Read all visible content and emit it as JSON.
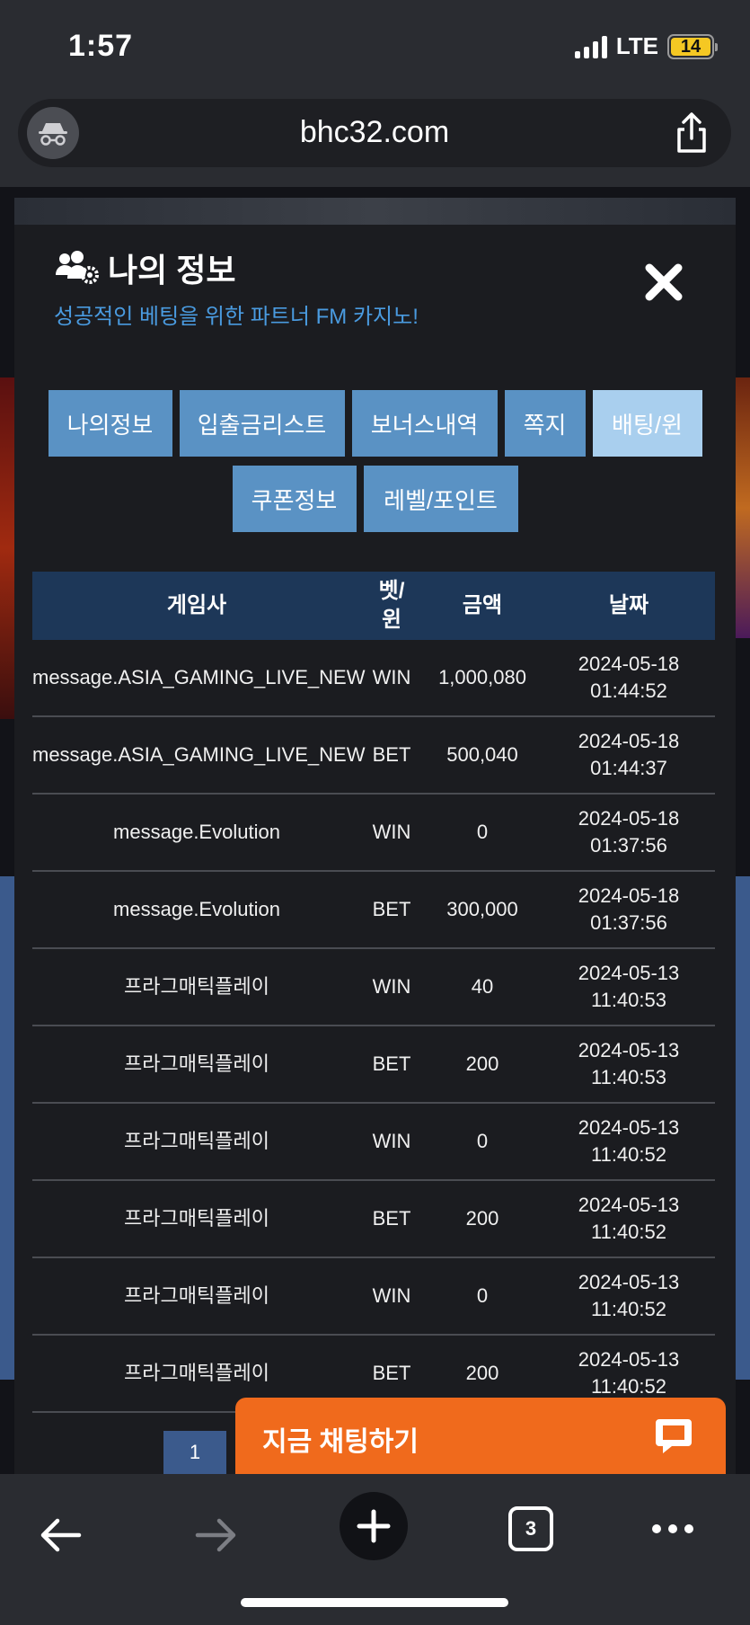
{
  "status_bar": {
    "time": "1:57",
    "network": "LTE",
    "battery": "14"
  },
  "browser": {
    "url": "bhc32.com"
  },
  "modal": {
    "title": "나의 정보",
    "subtitle": "성공적인 베팅을 위한 파트너 FM 카지노!",
    "tabs_row1": [
      {
        "label": "나의정보"
      },
      {
        "label": "입출금리스트"
      },
      {
        "label": "보너스내역"
      },
      {
        "label": "쪽지"
      },
      {
        "label": "배팅/윈"
      }
    ],
    "tabs_row2": [
      {
        "label": "쿠폰정보"
      },
      {
        "label": "레벨/포인트"
      }
    ],
    "active_tab": "배팅/윈"
  },
  "table": {
    "headers": {
      "provider": "게임사",
      "type": "벳/\n윈",
      "amount": "금액",
      "date": "날짜"
    },
    "rows": [
      {
        "provider": "message.ASIA_GAMING_LIVE_NEW",
        "type": "WIN",
        "amount": "1,000,080",
        "date": "2024-05-18",
        "time": "01:44:52"
      },
      {
        "provider": "message.ASIA_GAMING_LIVE_NEW",
        "type": "BET",
        "amount": "500,040",
        "date": "2024-05-18",
        "time": "01:44:37"
      },
      {
        "provider": "message.Evolution",
        "type": "WIN",
        "amount": "0",
        "date": "2024-05-18",
        "time": "01:37:56"
      },
      {
        "provider": "message.Evolution",
        "type": "BET",
        "amount": "300,000",
        "date": "2024-05-18",
        "time": "01:37:56"
      },
      {
        "provider": "프라그매틱플레이",
        "type": "WIN",
        "amount": "40",
        "date": "2024-05-13",
        "time": "11:40:53"
      },
      {
        "provider": "프라그매틱플레이",
        "type": "BET",
        "amount": "200",
        "date": "2024-05-13",
        "time": "11:40:53"
      },
      {
        "provider": "프라그매틱플레이",
        "type": "WIN",
        "amount": "0",
        "date": "2024-05-13",
        "time": "11:40:52"
      },
      {
        "provider": "프라그매틱플레이",
        "type": "BET",
        "amount": "200",
        "date": "2024-05-13",
        "time": "11:40:52"
      },
      {
        "provider": "프라그매틱플레이",
        "type": "WIN",
        "amount": "0",
        "date": "2024-05-13",
        "time": "11:40:52"
      },
      {
        "provider": "프라그매틱플레이",
        "type": "BET",
        "amount": "200",
        "date": "2024-05-13",
        "time": "11:40:52"
      }
    ]
  },
  "pagination": {
    "current_page": "1"
  },
  "chat": {
    "label": "지금 채팅하기"
  },
  "toolbar": {
    "tab_count": "3"
  },
  "colors": {
    "accent_blue": "#5a92c4",
    "active_tab": "#a9cfee",
    "header_bg": "#1d3758",
    "chat_orange": "#f06a1c",
    "subtitle_blue": "#4a9be0"
  },
  "icons": [
    "incognito-icon",
    "share-icon",
    "users-gear-icon",
    "close-icon",
    "chat-bubble-icon",
    "back-arrow-icon",
    "forward-arrow-icon",
    "plus-icon",
    "tabs-icon",
    "more-icon"
  ]
}
